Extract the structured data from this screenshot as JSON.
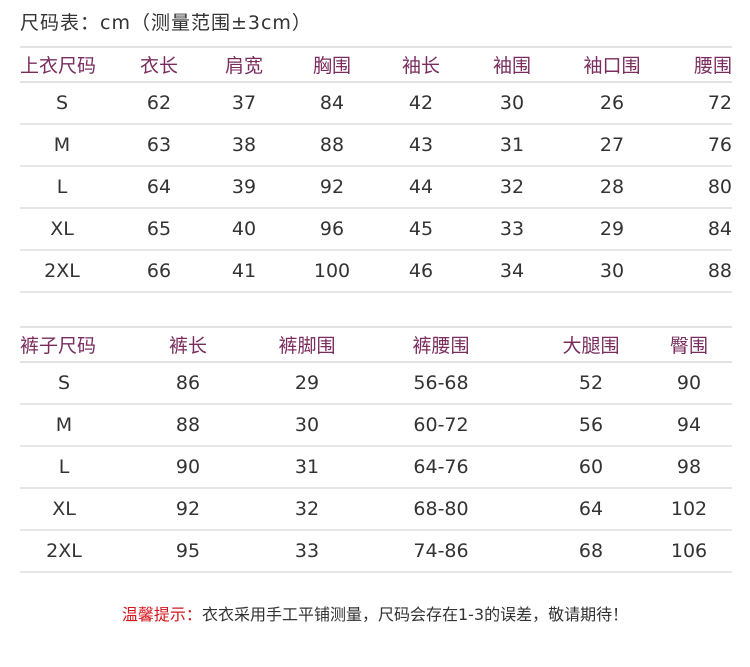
{
  "title": "尺码表：cm（测量范围±3cm）",
  "top_table": {
    "headers": [
      "上衣尺码",
      "衣长",
      "肩宽",
      "胸围",
      "袖长",
      "袖围",
      "袖口围",
      "腰围"
    ],
    "rows": [
      [
        "S",
        "62",
        "37",
        "84",
        "42",
        "30",
        "26",
        "72"
      ],
      [
        "M",
        "63",
        "38",
        "88",
        "43",
        "31",
        "27",
        "76"
      ],
      [
        "L",
        "64",
        "39",
        "92",
        "44",
        "32",
        "28",
        "80"
      ],
      [
        "XL",
        "65",
        "40",
        "96",
        "45",
        "33",
        "29",
        "84"
      ],
      [
        "2XL",
        "66",
        "41",
        "100",
        "46",
        "34",
        "30",
        "88"
      ]
    ]
  },
  "bottom_table": {
    "headers": [
      "裤子尺码",
      "裤长",
      "裤脚围",
      "裤腰围",
      "大腿围",
      "臀围"
    ],
    "rows": [
      [
        "S",
        "86",
        "29",
        "56-68",
        "52",
        "90"
      ],
      [
        "M",
        "88",
        "30",
        "60-72",
        "56",
        "94"
      ],
      [
        "L",
        "90",
        "31",
        "64-76",
        "60",
        "98"
      ],
      [
        "XL",
        "92",
        "32",
        "68-80",
        "64",
        "102"
      ],
      [
        "2XL",
        "95",
        "33",
        "74-86",
        "68",
        "106"
      ]
    ]
  },
  "note": {
    "label": "温馨提示：",
    "text": "衣衣采用手工平铺测量，尺码会存在1-3的误差，敬请期待！"
  },
  "colors": {
    "header_text": "#7a2c5e",
    "hint_text": "#d4171e"
  }
}
